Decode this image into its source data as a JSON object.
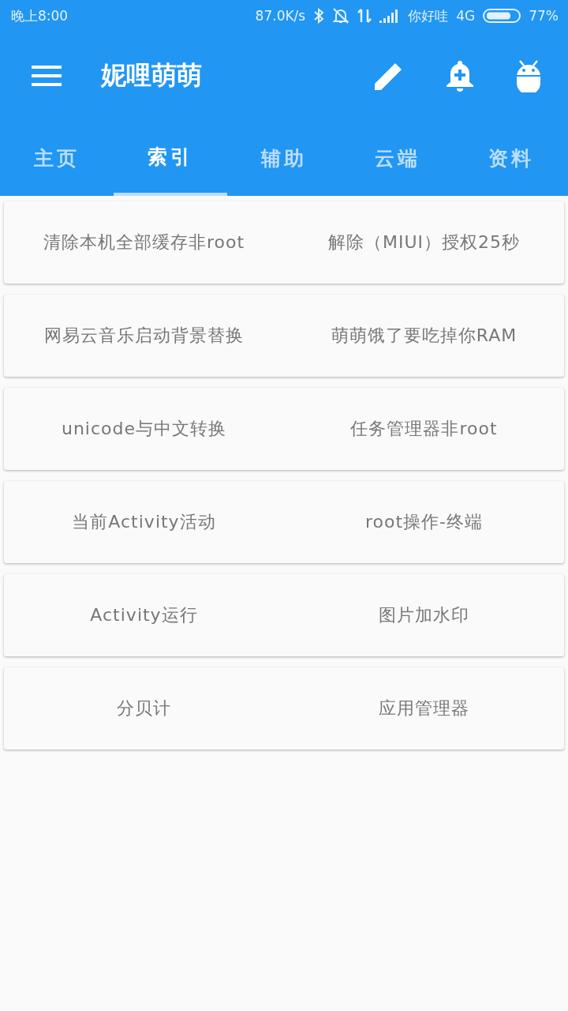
{
  "status_bar": {
    "time": "晚上8:00",
    "speed": "87.0K/s",
    "carrier": "你好哇",
    "network": "4G",
    "battery": "77%"
  },
  "toolbar": {
    "title": "妮哩萌萌"
  },
  "tabs": [
    {
      "label": "主页",
      "selected": false
    },
    {
      "label": "索引",
      "selected": true
    },
    {
      "label": "辅助",
      "selected": false
    },
    {
      "label": "云端",
      "selected": false
    },
    {
      "label": "资料",
      "selected": false
    }
  ],
  "cards": [
    {
      "items": [
        "清除本机全部缓存非root",
        "解除（MIUI）授权25秒"
      ]
    },
    {
      "items": [
        "网易云音乐启动背景替换",
        "萌萌饿了要吃掉你RAM"
      ]
    },
    {
      "items": [
        "unicode与中文转换",
        "任务管理器非root"
      ]
    },
    {
      "items": [
        "当前Activity活动",
        "root操作-终端"
      ]
    },
    {
      "items": [
        "Activity运行",
        "图片加水印"
      ]
    },
    {
      "items": [
        "分贝计",
        "应用管理器"
      ]
    }
  ]
}
